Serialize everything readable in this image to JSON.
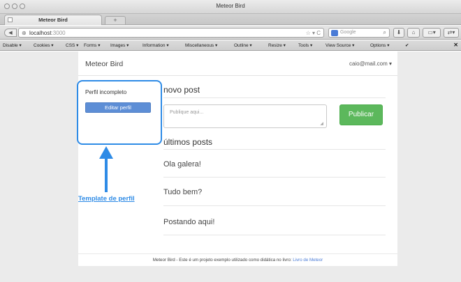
{
  "browser": {
    "window_title": "Meteor Bird",
    "tab_label": "Meteor Bird",
    "new_tab_label": "+",
    "url_host": "localhost",
    "url_port": ":3000",
    "search_placeholder": "Google"
  },
  "devtoolbar": {
    "items": [
      {
        "icon": "disable-icon",
        "label": "Disable ▾"
      },
      {
        "icon": "cookies-icon",
        "label": "Cookies ▾"
      },
      {
        "icon": "css-icon",
        "label": "CSS ▾"
      },
      {
        "icon": "forms-icon",
        "label": "Forms ▾"
      },
      {
        "icon": "images-icon",
        "label": "Images ▾"
      },
      {
        "icon": "information-icon",
        "label": "Information ▾"
      },
      {
        "icon": "miscellaneous-icon",
        "label": "Miscellaneous ▾"
      },
      {
        "icon": "outline-icon",
        "label": "Outline ▾"
      },
      {
        "icon": "resize-icon",
        "label": "Resize ▾"
      },
      {
        "icon": "tools-icon",
        "label": "Tools ▾"
      },
      {
        "icon": "view-source-icon",
        "label": "View Source ▾"
      },
      {
        "icon": "options-icon",
        "label": "Options ▾"
      }
    ]
  },
  "app": {
    "brand": "Meteor Bird",
    "user_email": "caio@mail.com ▾",
    "profile": {
      "status_text": "Perfil incompleto",
      "edit_button": "Editar perfil"
    },
    "new_post": {
      "heading": "novo post",
      "placeholder": "Publique aqui...",
      "publish_button": "Publicar"
    },
    "latest_posts": {
      "heading": "últimos posts",
      "items": [
        "Ola galera!",
        "Tudo bem?",
        "Postando aqui!"
      ]
    },
    "footer": {
      "text": "Meteor Bird - Este é um projeto exemplo utilizado como didática no livro:",
      "link": "Livro de Meteor"
    }
  },
  "annotation": {
    "label": "Template de perfil",
    "color": "#2e8be6"
  }
}
